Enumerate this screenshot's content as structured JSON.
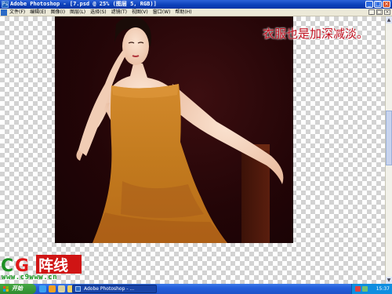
{
  "titlebar": {
    "app_icon": "photoshop-icon",
    "title": "Adobe Photoshop - [7.psd @ 25% (图层 5, RGB)]",
    "buttons": [
      "minimize",
      "maximize",
      "close"
    ]
  },
  "menu": {
    "items": [
      "文件(F)",
      "编辑(E)",
      "图像(I)",
      "图层(L)",
      "选择(S)",
      "滤镜(T)",
      "视图(V)",
      "窗口(W)",
      "帮助(H)"
    ],
    "doc_controls": [
      "_",
      "□",
      "×"
    ]
  },
  "canvas": {
    "caption": "衣服也是加深减淡。",
    "caption_color": "#c21020",
    "background_pattern": "transparency-checkerboard"
  },
  "watermark": {
    "logo_text": "CG阵线",
    "url": "www.c9www.cn"
  },
  "taskbar": {
    "start_label": "开始",
    "quick_launch": [
      "ie-icon",
      "media-icon",
      "desktop-icon",
      "folder-icon"
    ],
    "task_label": "Adobe Photoshop - ...",
    "clock": "15:37"
  },
  "colors": {
    "titlebar": "#0a3fb8",
    "taskbar": "#245edb",
    "start": "#2f8b2f",
    "dress": "#c27a1e",
    "background": "#230507"
  }
}
